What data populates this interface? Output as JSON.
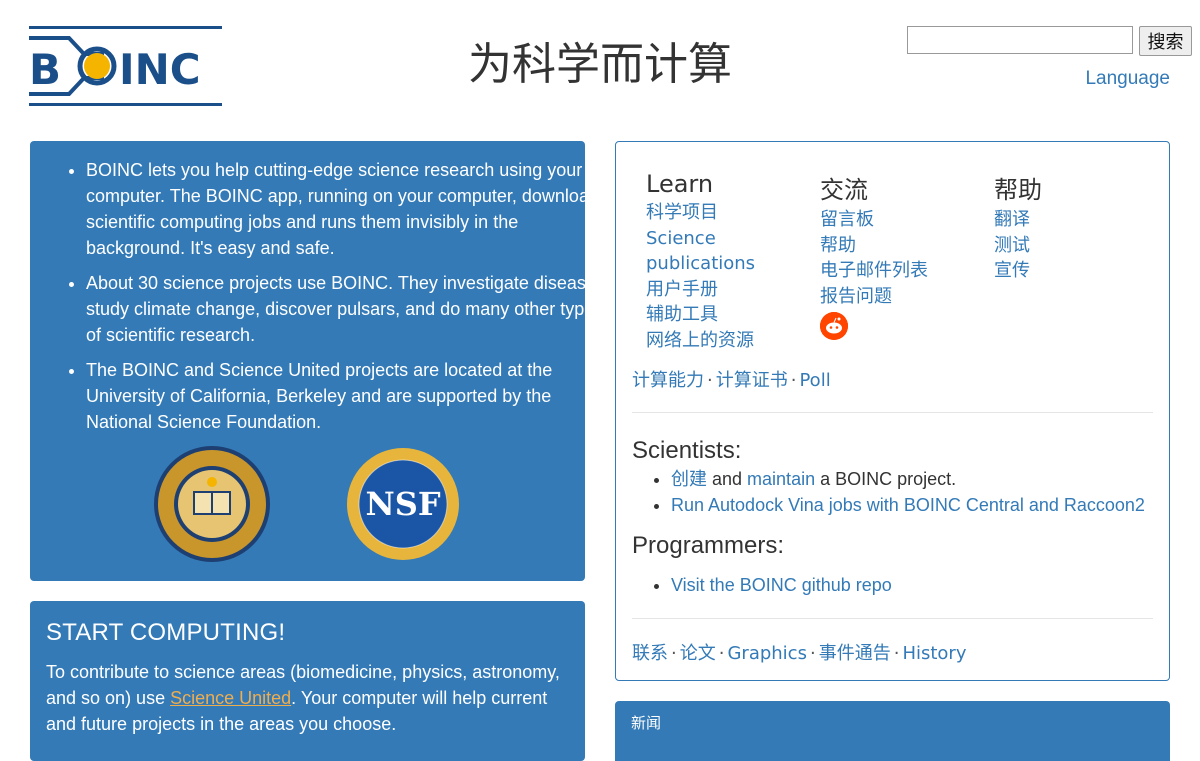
{
  "header": {
    "title": "为科学而计算",
    "search_button": "搜索",
    "language_link": "Language"
  },
  "intro": {
    "bullets": [
      "BOINC lets you help cutting-edge science research using your computer. The BOINC app, running on your computer, downloads scientific computing jobs and runs them invisibly in the background. It's easy and safe.",
      "About 30 science projects use BOINC. They investigate diseases, study climate change, discover pulsars, and do many other types of scientific research.",
      "The BOINC and Science United projects are located at the University of California, Berkeley and are supported by the National Science Foundation."
    ],
    "nsf_text": "NSF"
  },
  "start": {
    "heading": "START COMPUTING!",
    "text_before": "To contribute to science areas (biomedicine, physics, astronomy, and so on) use ",
    "link": "Science United",
    "text_after": ". Your computer will help current and future projects in the areas you choose."
  },
  "learn": {
    "heading": "Learn",
    "links": [
      "科学项目",
      "Science",
      "publications",
      "用户手册",
      "辅助工具",
      "网络上的资源"
    ]
  },
  "community": {
    "heading": "交流",
    "links": [
      "留言板",
      "帮助",
      "电子邮件列表",
      "报告问题"
    ]
  },
  "help": {
    "heading": "帮助",
    "links": [
      "翻译",
      "测试",
      "宣传"
    ]
  },
  "row_links": [
    "计算能力",
    "计算证书",
    "Poll"
  ],
  "scientists": {
    "heading": "Scientists:",
    "item1_link1": "创建",
    "item1_and": " and ",
    "item1_link2": "maintain",
    "item1_tail": " a BOINC project.",
    "item2_link": "Run Autodock Vina jobs with BOINC Central and Raccoon2"
  },
  "programmers": {
    "heading": "Programmers:",
    "item_link": "Visit the BOINC github repo"
  },
  "footer_links": [
    "联系",
    "论文",
    "Graphics",
    "事件通告",
    "History"
  ],
  "news": {
    "title": "新闻"
  },
  "colors": {
    "primary": "#337ab7",
    "accent": "#f0ad4e",
    "reddit": "#ff4500"
  }
}
